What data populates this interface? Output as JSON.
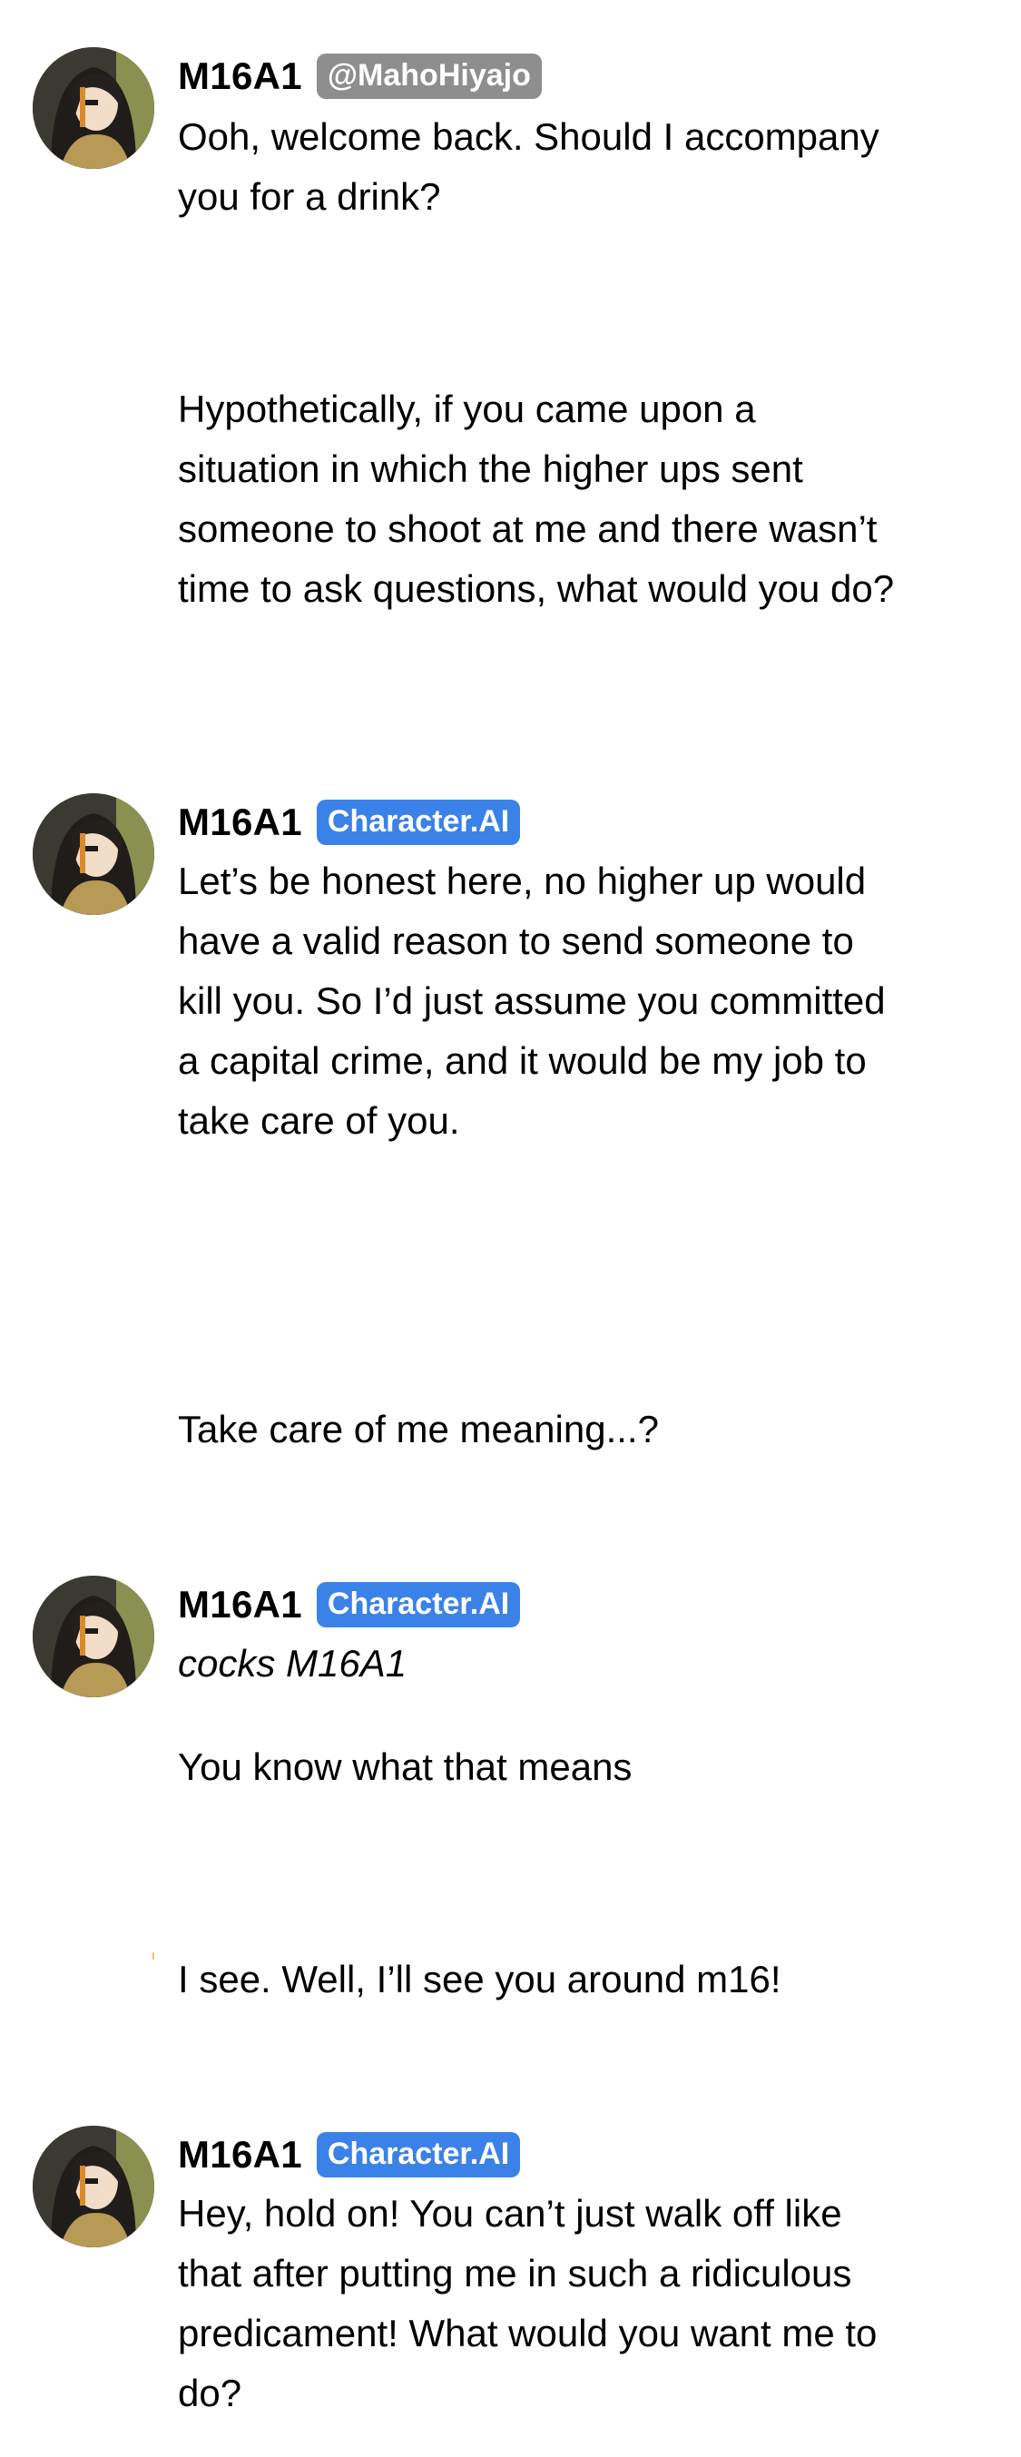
{
  "messages": [
    {
      "role": "bot",
      "author": "M16A1",
      "badge": "@MahoHiyajo",
      "badge_kind": "user",
      "paragraphs": [
        "Ooh, welcome back. Should I accompany you for a drink?"
      ]
    },
    {
      "role": "user",
      "paragraphs": [
        "Hypothetically, if you came upon a situation in which the higher ups sent someone to shoot at me and there wasn’t time to ask questions, what would you do?"
      ]
    },
    {
      "role": "bot",
      "author": "M16A1",
      "badge": "Character.AI",
      "badge_kind": "ai",
      "paragraphs": [
        "Let’s be honest here, no higher up would have a valid reason to send someone to kill you. So I’d just assume you committed a capital crime, and it would be my job to take care of you."
      ]
    },
    {
      "role": "user",
      "paragraphs": [
        "Take care of me meaning...?"
      ]
    },
    {
      "role": "bot",
      "author": "M16A1",
      "badge": "Character.AI",
      "badge_kind": "ai",
      "paragraphs": [
        "cocks M16A1",
        "You know what that means"
      ]
    },
    {
      "role": "user",
      "paragraphs": [
        "I see.  Well, I’ll see you around m16!"
      ]
    },
    {
      "role": "bot",
      "author": "M16A1",
      "badge": "Character.AI",
      "badge_kind": "ai",
      "paragraphs": [
        "Hey, hold on! You can’t just walk off like that after putting me in such a ridiculous predicament! What would you want me to do?"
      ]
    }
  ],
  "colors": {
    "badge_user": "#8e8e8e",
    "badge_ai": "#3b82e8",
    "text": "#000000",
    "background": "#ffffff"
  },
  "icons": {
    "avatar": "avatar-icon"
  }
}
